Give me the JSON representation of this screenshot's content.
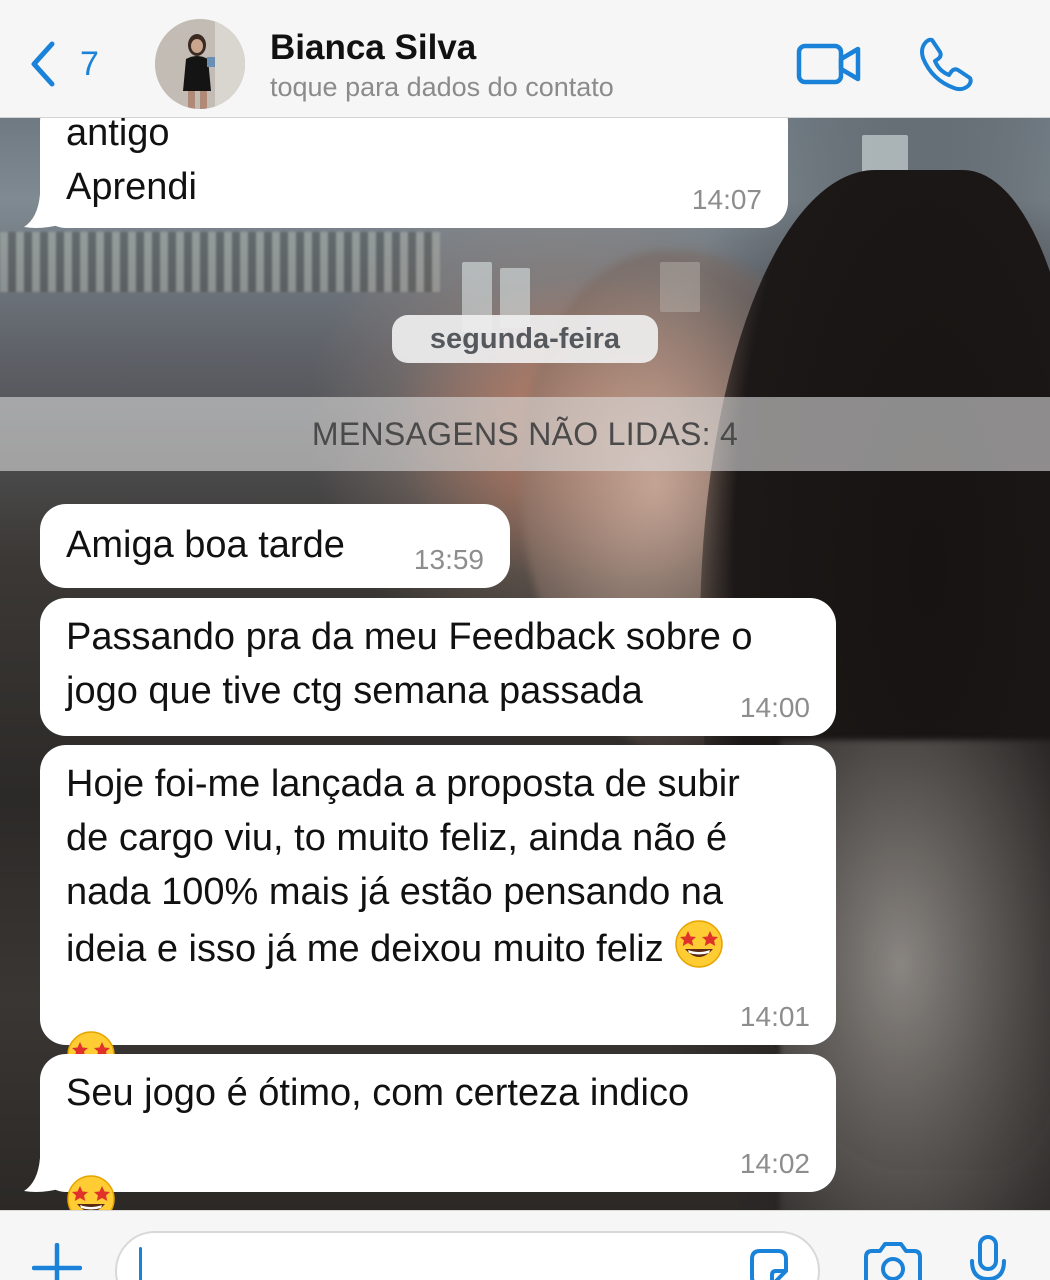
{
  "header": {
    "back_count": "7",
    "contact_name": "Bianca Silva",
    "contact_subtitle": "toque para dados do contato"
  },
  "messages": [
    {
      "text": "antigo\nAprendi",
      "time": "14:07"
    },
    {
      "text": "Amiga boa tarde",
      "time": "13:59"
    },
    {
      "text": "Passando pra da meu Feedback sobre o\njogo que tive ctg semana passada",
      "time": "14:00"
    },
    {
      "text": "Hoje foi-me lançada a proposta de subir\nde cargo viu, to muito feliz, ainda não é\nnada 100% mais já estão pensando na\nideia e isso já me deixou muito feliz ",
      "time": "14:01",
      "emoji": "star-struck"
    },
    {
      "text": "Seu jogo é ótimo, com certeza indico",
      "time": "14:02",
      "emoji": "star-struck"
    }
  ],
  "date_divider": "segunda-feira",
  "unread_banner": "MENSAGENS NÃO LIDAS: 4",
  "input": {
    "value": "",
    "placeholder": ""
  },
  "colors": {
    "accent": "#1a82d8",
    "bubble": "#ffffff",
    "time": "#8d8d8d"
  }
}
